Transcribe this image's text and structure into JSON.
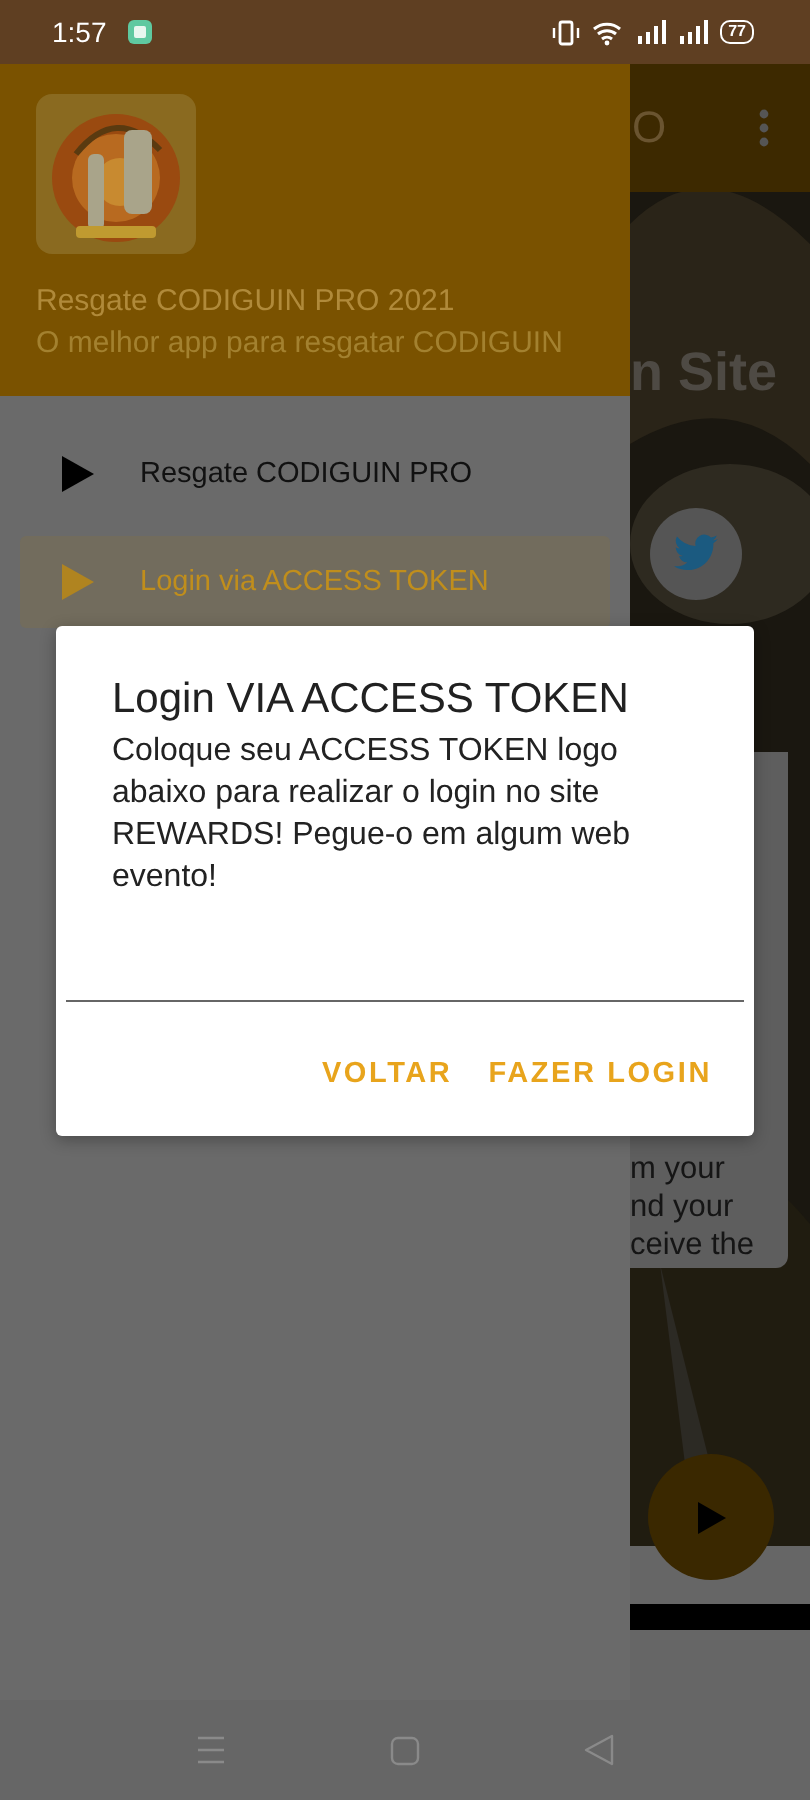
{
  "status_bar": {
    "time": "1:57",
    "battery": "77"
  },
  "drawer": {
    "header": {
      "title": "Resgate CODIGUIN PRO 2021",
      "subtitle": "O melhor app para resgatar CODIGUIN"
    },
    "items": [
      {
        "label": "Resgate CODIGUIN PRO",
        "selected": false
      },
      {
        "label": "Login via ACCESS TOKEN",
        "selected": true
      }
    ]
  },
  "background_app": {
    "toolbar_title": "O",
    "heading": "n Site",
    "card_lines": [
      "m your",
      "nd your",
      "ceive the"
    ]
  },
  "dialog": {
    "title": "Login VIA ACCESS TOKEN",
    "message": "Coloque seu ACCESS TOKEN logo abaixo para realizar o login no site REWARDS! Pegue-o em algum web evento!",
    "buttons": [
      "VOLTAR",
      "FAZER LOGIN"
    ]
  }
}
